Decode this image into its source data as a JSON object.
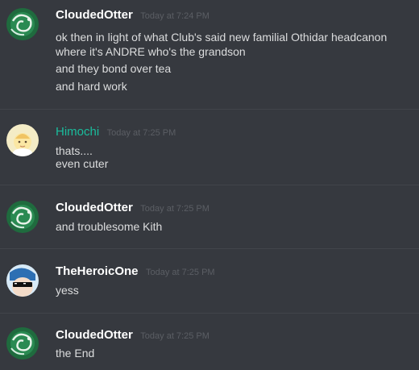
{
  "messages": [
    {
      "username": "CloudedOtter",
      "timestamp": "Today at 7:24 PM",
      "lines": [
        "ok then in light of what Club's said new familial Othidar headcanon",
        "where it's ANDRE who's the grandson",
        "and they bond over tea",
        "and hard work"
      ]
    },
    {
      "username": "Himochi",
      "timestamp": "Today at 7:25 PM",
      "lines": [
        "thats....",
        "even cuter"
      ]
    },
    {
      "username": "CloudedOtter",
      "timestamp": "Today at 7:25 PM",
      "lines": [
        "and troublesome Kith"
      ]
    },
    {
      "username": "TheHeroicOne",
      "timestamp": "Today at 7:25 PM",
      "lines": [
        "yess"
      ]
    },
    {
      "username": "CloudedOtter",
      "timestamp": "Today at 7:25 PM",
      "lines": [
        "the End"
      ]
    }
  ],
  "colors": {
    "background": "#36393f",
    "username_default": "#ffffff",
    "username_himochi": "#1abc9c",
    "message_text": "#dcddde",
    "timestamp": "#5b5e64",
    "divider": "#42454b"
  }
}
